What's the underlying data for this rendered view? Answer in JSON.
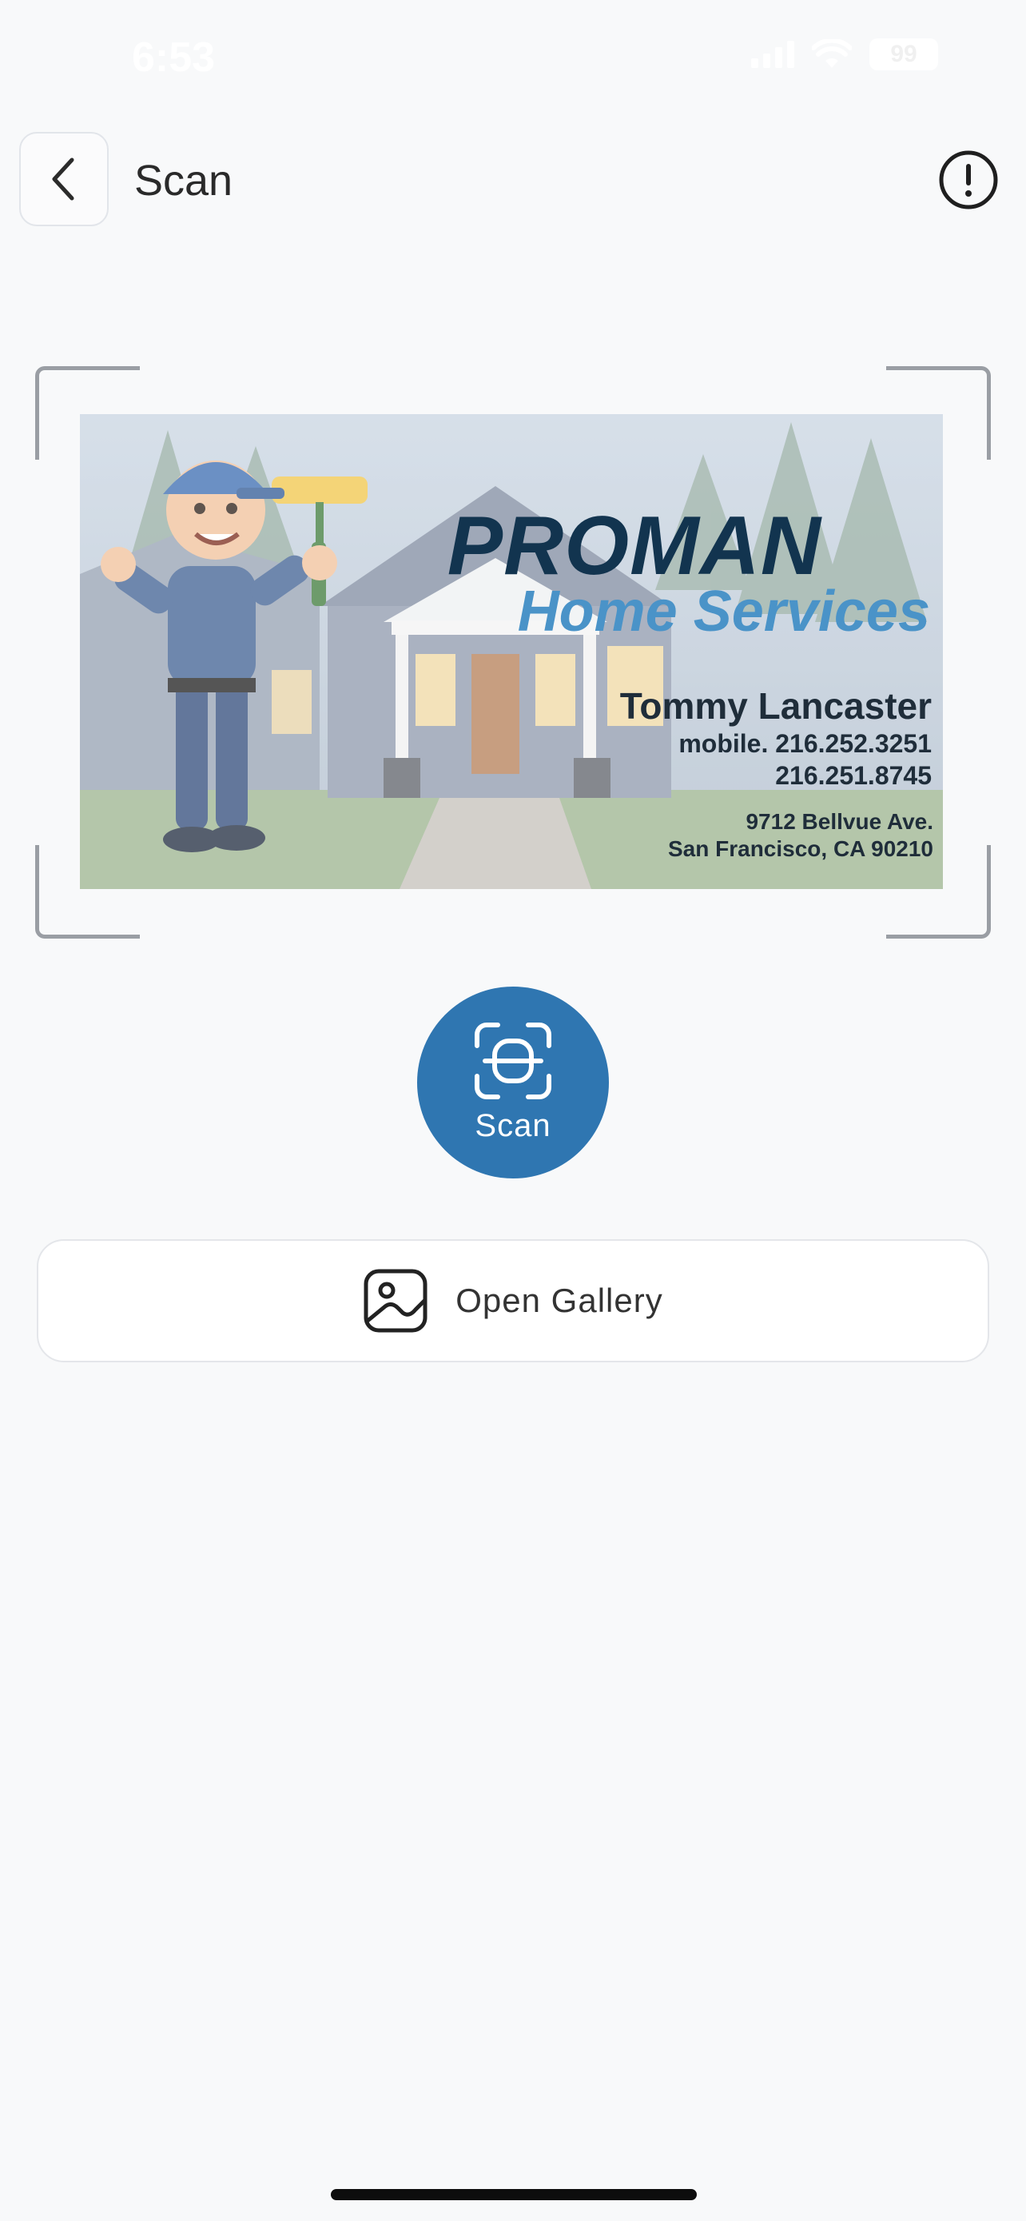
{
  "status_bar": {
    "time": "6:53",
    "battery": "99"
  },
  "header": {
    "title": "Scan"
  },
  "card": {
    "brand": "PROMAN",
    "sub_brand": "Home Services",
    "name": "Tommy Lancaster",
    "mobile": "mobile. 216.252.3251",
    "phone": "216.251.8745",
    "address_line1": "9712 Bellvue Ave.",
    "address_line2": "San Francisco, CA 90210"
  },
  "scan_button": {
    "label": "Scan"
  },
  "gallery_button": {
    "label": "Open Gallery"
  },
  "colors": {
    "accent": "#2f76b1",
    "background": "#f8f9fa",
    "frame_corner": "#9a9ea4"
  },
  "icons": {
    "back": "chevron-left-icon",
    "info": "info-circle-icon",
    "scan": "scan-frame-icon",
    "gallery": "image-icon"
  }
}
